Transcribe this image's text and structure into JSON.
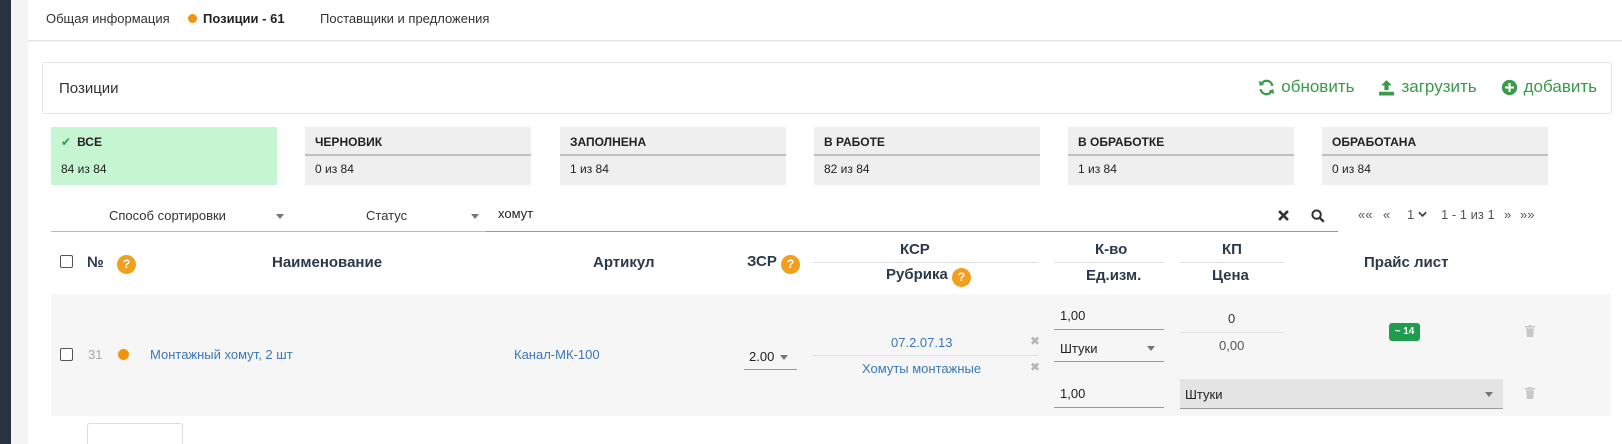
{
  "tabs": [
    {
      "label": "Общая информация",
      "active": false
    },
    {
      "label": "Позиции - 61",
      "active": true
    },
    {
      "label": "Поставщики и предложения",
      "active": false
    }
  ],
  "panel": {
    "title": "Позиции",
    "actions": [
      {
        "label": "обновить",
        "icon": "refresh-icon"
      },
      {
        "label": "загрузить",
        "icon": "upload-icon"
      },
      {
        "label": "добавить",
        "icon": "plus-circle-icon"
      }
    ]
  },
  "statuses": [
    {
      "label": "ВСЕ",
      "count": "84 из 84",
      "active": true
    },
    {
      "label": "ЧЕРНОВИК",
      "count": "0 из 84",
      "active": false
    },
    {
      "label": "ЗАПОЛНЕНА",
      "count": "1 из 84",
      "active": false
    },
    {
      "label": "В РАБОТЕ",
      "count": "82 из 84",
      "active": false
    },
    {
      "label": "В ОБРАБОТКЕ",
      "count": "1 из 84",
      "active": false
    },
    {
      "label": "ОБРАБОТАНА",
      "count": "0 из 84",
      "active": false
    }
  ],
  "filters": {
    "sort": "Способ сортировки",
    "status": "Статус",
    "search_value": "хомут"
  },
  "pagination": {
    "first": "««",
    "prev": "«",
    "page": "1",
    "range": "1 - 1 из 1",
    "next": "»",
    "last": "»»"
  },
  "table": {
    "headers": {
      "number": "№",
      "help": "?",
      "name": "Наименование",
      "article": "Артикул",
      "zsr": "ЗСР",
      "ksr": "КСР",
      "rubric": "Рубрика",
      "qty": "К-во",
      "unit": "Ед.изм.",
      "kp": "КП",
      "price": "Цена",
      "pricelist": "Прайс лист"
    },
    "row": {
      "number": "31",
      "name": "Монтажный хомут, 2 шт",
      "article": "Канал-МК-100",
      "zsr": "2.00",
      "ksr": "07.2.07.13",
      "rubric": "Хомуты монтажные",
      "qty": "1,00",
      "unit": "Штуки",
      "kp": "0",
      "price": "0,00",
      "pricelist_badge": "~ 14",
      "qty2": "1,00",
      "unit2": "Штуки"
    }
  },
  "colors": {
    "accent_green": "#3a9a4a",
    "status_dot": "#f0930f",
    "active_status_bg": "#c6f5d2",
    "badge_green": "#1e9d4f",
    "link_blue": "#3a77b8"
  }
}
